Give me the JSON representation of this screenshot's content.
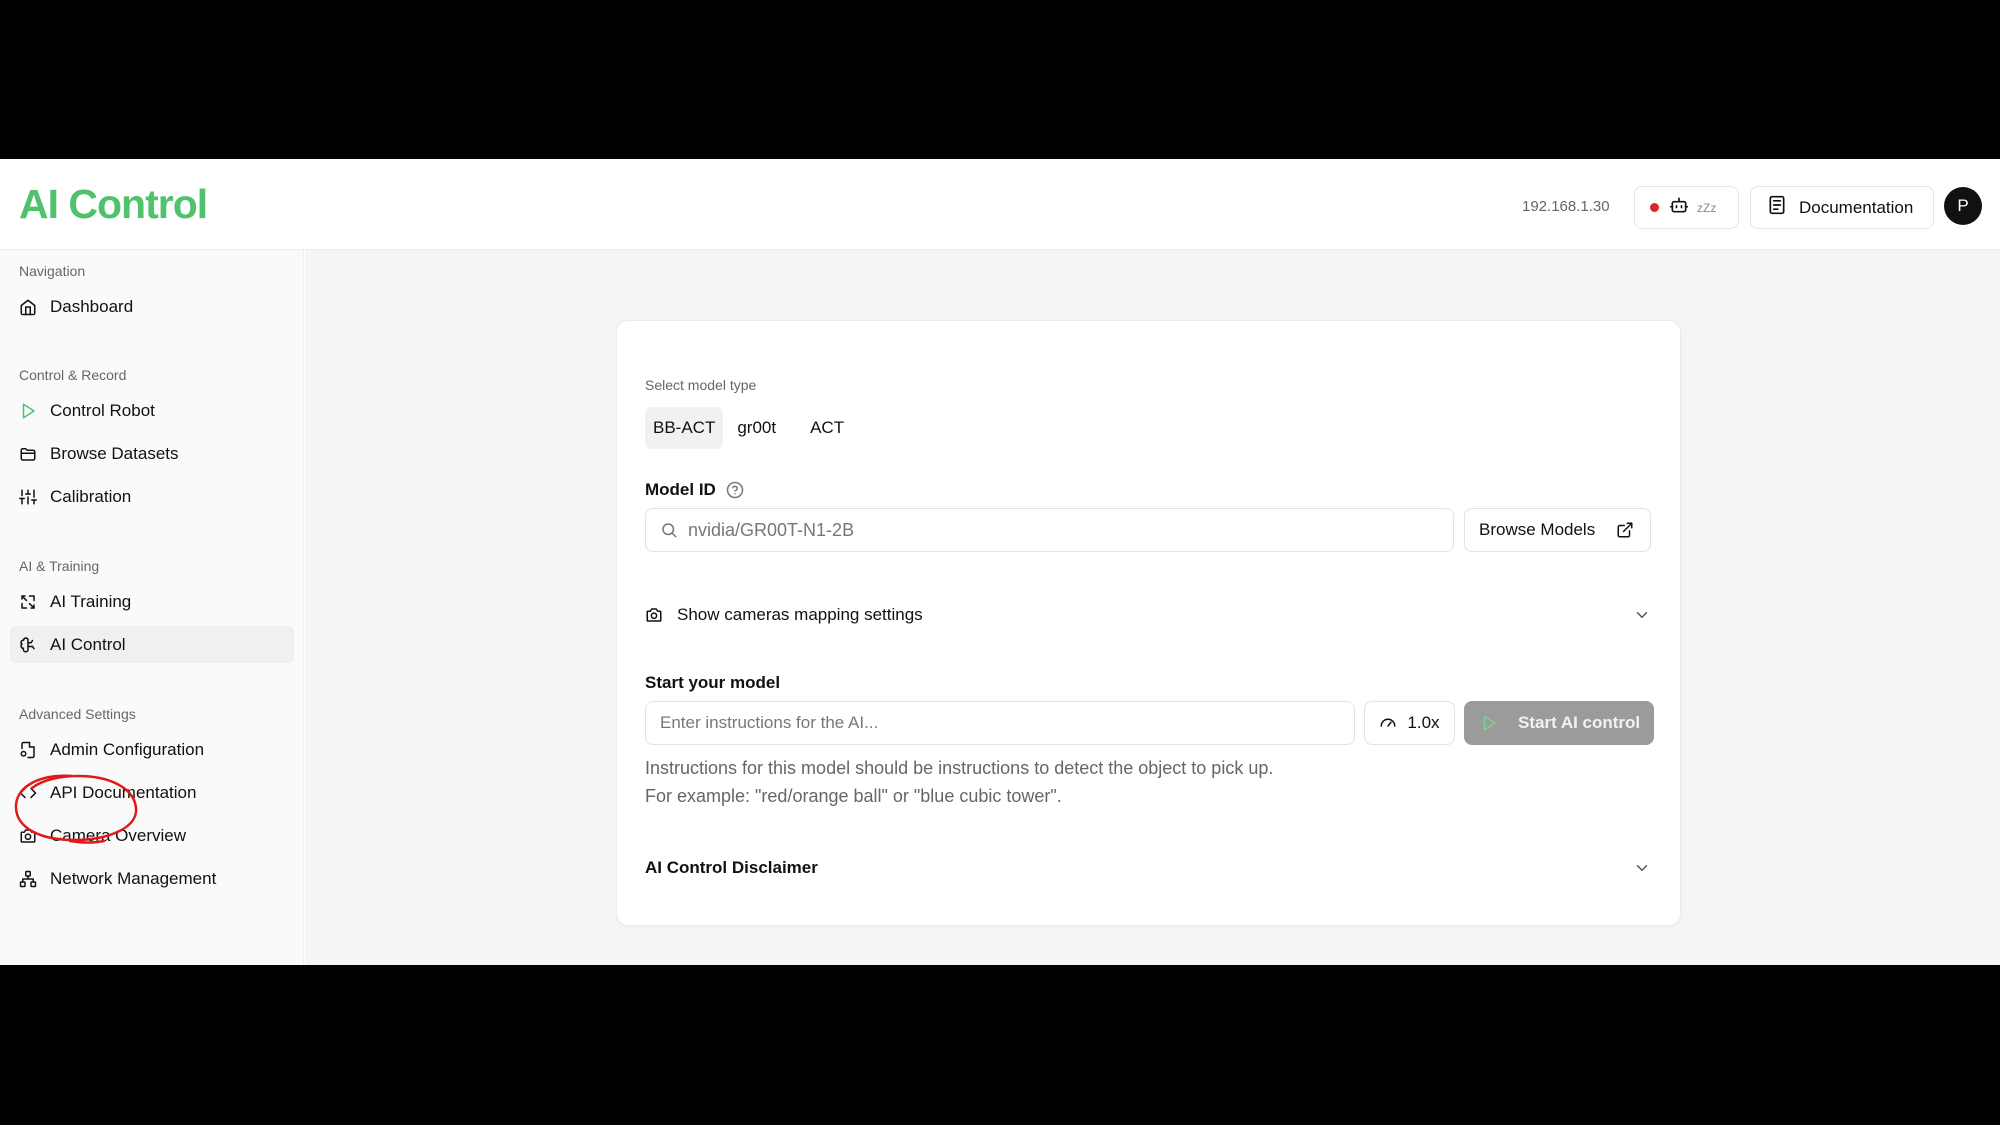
{
  "header": {
    "title": "AI Control",
    "ip_address": "192.168.1.30",
    "robot_status_text": "zZz",
    "status_color": "#e02424",
    "documentation_label": "Documentation",
    "avatar_initial": "P",
    "accent_color": "#4fc26b"
  },
  "sidebar": {
    "groups": [
      {
        "label": "Navigation",
        "items": [
          {
            "label": "Dashboard",
            "icon": "home-icon"
          }
        ]
      },
      {
        "label": "Control & Record",
        "items": [
          {
            "label": "Control Robot",
            "icon": "play-icon"
          },
          {
            "label": "Browse Datasets",
            "icon": "folder-icon"
          },
          {
            "label": "Calibration",
            "icon": "sliders-icon"
          }
        ]
      },
      {
        "label": "AI & Training",
        "items": [
          {
            "label": "AI Training",
            "icon": "training-icon"
          },
          {
            "label": "AI Control",
            "icon": "brain-icon",
            "active": true
          }
        ]
      },
      {
        "label": "Advanced Settings",
        "items": [
          {
            "label": "Admin Configuration",
            "icon": "file-cog-icon"
          },
          {
            "label": "API Documentation",
            "icon": "code-icon"
          },
          {
            "label": "Camera Overview",
            "icon": "camera-icon"
          },
          {
            "label": "Network Management",
            "icon": "network-icon"
          }
        ]
      }
    ]
  },
  "main": {
    "select_model_type_label": "Select model type",
    "model_types": [
      "BB-ACT",
      "gr00t",
      "ACT"
    ],
    "selected_model_type": "BB-ACT",
    "model_id_label": "Model ID",
    "model_id_placeholder": "nvidia/GR00T-N1-2B",
    "browse_models_label": "Browse Models",
    "cameras_mapping_label": "Show cameras mapping settings",
    "start_model_label": "Start your model",
    "instructions_placeholder": "Enter instructions for the AI...",
    "speed_label": "1.0x",
    "start_button_label": "Start AI control",
    "help_line_1": "Instructions for this model should be instructions to detect the object to pick up.",
    "help_line_2": "For example: \"red/orange ball\" or \"blue cubic tower\".",
    "disclaimer_label": "AI Control Disclaimer"
  }
}
